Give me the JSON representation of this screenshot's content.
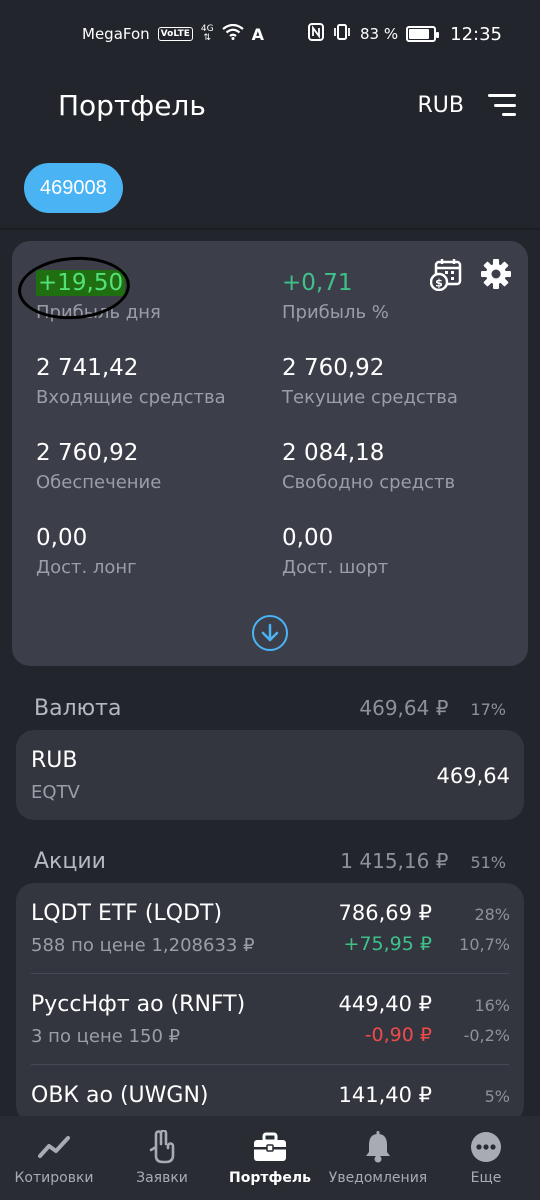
{
  "status_bar": {
    "carrier": "MegaFon",
    "volte": "VoLTE",
    "network": "4G",
    "battery_percent": "83 %",
    "battery_level": 0.83,
    "time": "12:35"
  },
  "header": {
    "title": "Портфель",
    "currency": "RUB"
  },
  "account": {
    "number": "469008"
  },
  "summary": {
    "day_profit": {
      "value": "+19,50",
      "label": "Прибыль дня"
    },
    "profit_pct": {
      "value": "+0,71",
      "label": "Прибыль %"
    },
    "incoming": {
      "value": "2 741,42",
      "label": "Входящие средства"
    },
    "current": {
      "value": "2 760,92",
      "label": "Текущие средства"
    },
    "collateral": {
      "value": "2 760,92",
      "label": "Обеспечение"
    },
    "free": {
      "value": "2 084,18",
      "label": "Свободно средств"
    },
    "long": {
      "value": "0,00",
      "label": "Дост. лонг"
    },
    "short": {
      "value": "0,00",
      "label": "Дост. шорт"
    }
  },
  "currency_section": {
    "title": "Валюта",
    "sum": "469,64 ₽",
    "pct": "17%",
    "items": [
      {
        "name": "RUB",
        "sub": "EQTV",
        "value": "469,64"
      }
    ]
  },
  "stocks_section": {
    "title": "Акции",
    "sum": "1 415,16 ₽",
    "pct": "51%",
    "items": [
      {
        "name": "LQDT ETF (LQDT)",
        "sub": "588 по цене 1,208633 ₽",
        "price": "786,69 ₽",
        "change": "+75,95 ₽",
        "share": "28%",
        "share_change": "10,7%"
      },
      {
        "name": "РуссНфт ао (RNFT)",
        "sub": "3 по цене 150 ₽",
        "price": "449,40 ₽",
        "change": "-0,90 ₽",
        "share": "16%",
        "share_change": "-0,2%"
      },
      {
        "name": "ОВК ао (UWGN)",
        "sub": "",
        "price": "141,40 ₽",
        "change": "",
        "share": "5%",
        "share_change": ""
      }
    ]
  },
  "bottom_nav": [
    {
      "label": "Котировки",
      "icon": "chart-line-icon"
    },
    {
      "label": "Заявки",
      "icon": "hand-icon"
    },
    {
      "label": "Портфель",
      "icon": "briefcase-icon"
    },
    {
      "label": "Уведомления",
      "icon": "bell-icon"
    },
    {
      "label": "Еще",
      "icon": "more-dots-icon"
    }
  ],
  "colors": {
    "background": "#23252c",
    "card": "#3c3f49",
    "accent": "#4ab3f4",
    "positive": "#3ec28a",
    "negative": "#f04a4a"
  }
}
